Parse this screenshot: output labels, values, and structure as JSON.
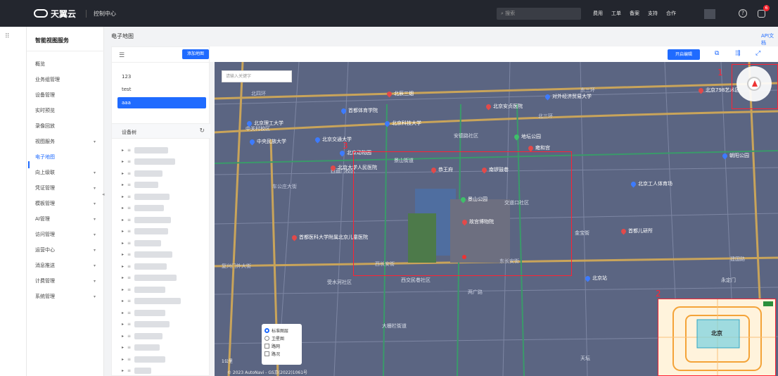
{
  "header": {
    "brand": "天翼云",
    "console": "控制中心",
    "search_placeholder": "搜索",
    "nav": [
      "费用",
      "工单",
      "备案",
      "支持",
      "合作"
    ],
    "help": "?",
    "notification_count": "6"
  },
  "sidebar": {
    "service_title": "智能视图服务",
    "items": [
      {
        "label": "概览",
        "chevron": false
      },
      {
        "label": "业务组管理",
        "chevron": false
      },
      {
        "label": "设备管理",
        "chevron": false
      },
      {
        "label": "实时预览",
        "chevron": false
      },
      {
        "label": "录像回放",
        "chevron": false
      },
      {
        "label": "视图服务",
        "chevron": true
      },
      {
        "label": "电子地图",
        "chevron": false,
        "active": true
      },
      {
        "label": "向上级联",
        "chevron": true
      },
      {
        "label": "凭证管理",
        "chevron": true
      },
      {
        "label": "模板管理",
        "chevron": true
      },
      {
        "label": "AI管理",
        "chevron": true
      },
      {
        "label": "访问管理",
        "chevron": true
      },
      {
        "label": "运营中心",
        "chevron": true
      },
      {
        "label": "消息推送",
        "chevron": true
      },
      {
        "label": "计费管理",
        "chevron": true
      },
      {
        "label": "系统管理",
        "chevron": true
      }
    ]
  },
  "content": {
    "title": "电子地图",
    "api_link": "API文档"
  },
  "map_panel": {
    "add_map_button": "添加地图",
    "maps": [
      "123",
      "test",
      "aaa"
    ],
    "selected_map": "aaa",
    "device_tree_label": "设备树"
  },
  "map_toolbar": {
    "edit_button": "开启编辑"
  },
  "map": {
    "search_placeholder": "请输入关键字",
    "labels": {
      "road1": "北四环",
      "road2": "北三环",
      "road3": "西长安街",
      "road4": "复兴门外大街",
      "road5": "东长安街",
      "road6": "建国路",
      "road7": "两广路",
      "road8": "东三环",
      "road9": "车公庄大街",
      "area1": "安德路社区",
      "area2": "景山街道",
      "area3": "交道口社区",
      "area4": "金宝街",
      "area5": "受水河社区",
      "area6": "西交民巷社区",
      "area7": "大栅栏街道",
      "area8": "中关村校区",
      "area9": "西直门校区",
      "area10": "天坛",
      "area11": "永定门"
    },
    "pois": [
      {
        "name": "北辰三烟",
        "color": "red"
      },
      {
        "name": "对外经济贸易大学",
        "color": "blue"
      },
      {
        "name": "首都体育学院",
        "color": "blue"
      },
      {
        "name": "北京安贞医院",
        "color": "red"
      },
      {
        "name": "北京理工大学",
        "color": "blue"
      },
      {
        "name": "北京科技大学",
        "color": "blue"
      },
      {
        "name": "北京交通大学",
        "color": "blue"
      },
      {
        "name": "中央民族大学",
        "color": "blue"
      },
      {
        "name": "地坛公园",
        "color": "green"
      },
      {
        "name": "雍和宫",
        "color": "red"
      },
      {
        "name": "北京动物园",
        "color": "blue"
      },
      {
        "name": "北京大学人民医院",
        "color": "red"
      },
      {
        "name": "恭王府",
        "color": "red"
      },
      {
        "name": "南锣鼓巷",
        "color": "red"
      },
      {
        "name": "景山公园",
        "color": "green"
      },
      {
        "name": "故宫博物院",
        "color": "red"
      },
      {
        "name": "首都医科大学附属北京儿童医院",
        "color": "red"
      },
      {
        "name": "首都儿研所",
        "color": "red"
      },
      {
        "name": "北京工人体育场",
        "color": "blue"
      },
      {
        "name": "北京站",
        "color": "blue"
      },
      {
        "name": "朝阳公园",
        "color": "blue"
      },
      {
        "name": "北京798艺术区",
        "color": "red"
      }
    ],
    "annotations": [
      "1",
      "2",
      "3"
    ],
    "layers": {
      "standard": "标准图层",
      "satellite": "卫星图",
      "roadnet": "路网",
      "traffic": "路况"
    },
    "scale": "1公里",
    "copyright": "© 2023 AutoNavi - GS京(2022)1061号",
    "overview_label": "北京"
  },
  "colors": {
    "accent": "#1f6bff",
    "topbar": "#23262e",
    "annotation": "#ff2233"
  }
}
